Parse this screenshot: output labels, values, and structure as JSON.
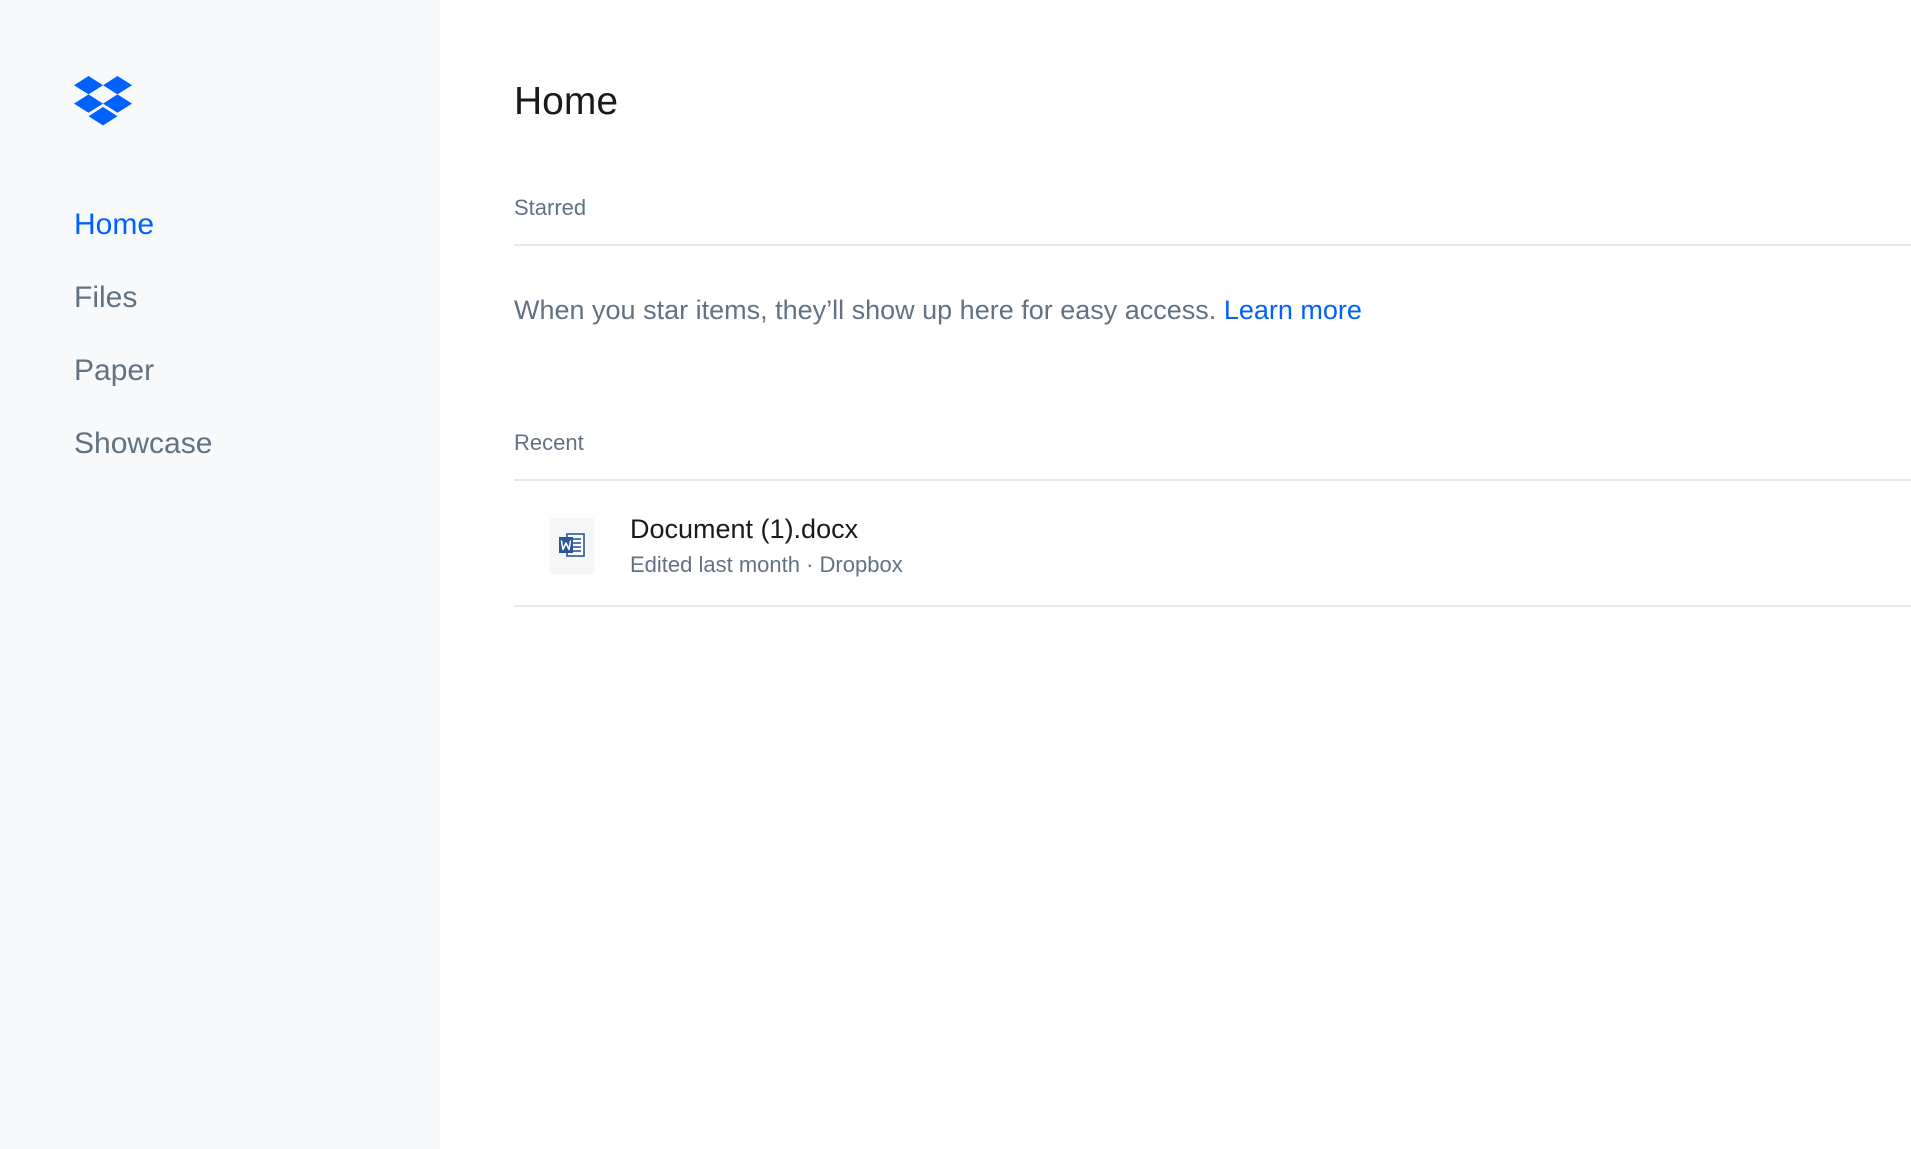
{
  "brand": {
    "logo_icon": "dropbox-logo-icon",
    "accent_color": "#0061fe"
  },
  "sidebar": {
    "items": [
      {
        "label": "Home",
        "active": true
      },
      {
        "label": "Files",
        "active": false
      },
      {
        "label": "Paper",
        "active": false
      },
      {
        "label": "Showcase",
        "active": false
      }
    ]
  },
  "main": {
    "title": "Home",
    "starred": {
      "label": "Starred",
      "empty_message": "When you star items, they’ll show up here for easy access.",
      "learn_more": "Learn more"
    },
    "recent": {
      "label": "Recent",
      "files": [
        {
          "name": "Document (1).docx",
          "edited": "Edited last month",
          "separator": " · ",
          "location": "Dropbox",
          "icon": "word-document-icon"
        }
      ]
    }
  }
}
